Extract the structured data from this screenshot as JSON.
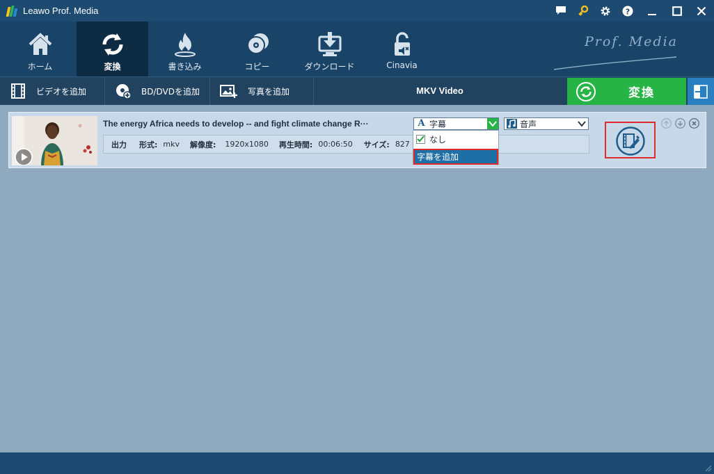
{
  "app": {
    "title": "Leawo Prof. Media",
    "brand": "Prof. Media"
  },
  "titlebar_icons": [
    "chat-icon",
    "key-icon",
    "gear-icon",
    "help-icon",
    "minimize-icon",
    "maximize-icon",
    "close-icon"
  ],
  "nav": {
    "tabs": [
      {
        "label": "ホーム",
        "icon": "home-icon"
      },
      {
        "label": "変換",
        "icon": "convert-icon",
        "active": true
      },
      {
        "label": "書き込み",
        "icon": "burn-icon"
      },
      {
        "label": "コピー",
        "icon": "copy-icon"
      },
      {
        "label": "ダウンロード",
        "icon": "download-icon"
      },
      {
        "label": "Cinavia",
        "icon": "cinavia-icon"
      }
    ]
  },
  "toolbar": {
    "add_video": "ビデオを追加",
    "add_disc": "BD/DVDを追加",
    "add_photo": "写真を追加",
    "format": "MKV Video",
    "convert": "変換"
  },
  "item": {
    "title": "The energy Africa needs to develop -- and fight climate change  R···",
    "output_label": "出力",
    "format_label": "形式:",
    "format_value": "mkv",
    "resolution_label": "解像度:",
    "resolution_value": "1920x1080",
    "duration_label": "再生時間:",
    "duration_value": "00:06:50",
    "size_label": "サイズ:",
    "size_value": "827",
    "subtitle_select": "字幕",
    "audio_select": "音声",
    "dropdown": {
      "none": "なし",
      "add": "字幕を追加"
    }
  },
  "colors": {
    "titlebar": "#1d4a70",
    "nav_bg": "#1a4368",
    "nav_active": "#0e2b44",
    "content_bg": "#8faabe",
    "convert_green": "#27b446",
    "highlight_red": "#e02a2a"
  }
}
